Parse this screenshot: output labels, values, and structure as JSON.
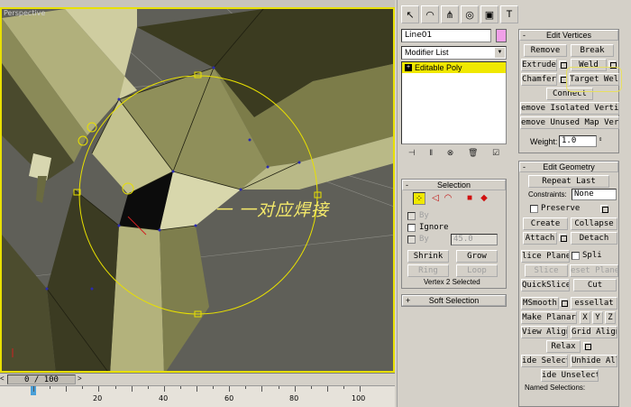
{
  "viewport": {
    "label": "Perspective",
    "annotation": "一 一对应焊接"
  },
  "time": {
    "frame_display": "0 / 100",
    "prev_arrow": "<",
    "next_arrow": ">",
    "ticks": [
      "20",
      "40",
      "60",
      "80",
      "100"
    ]
  },
  "panel": {
    "tab_icons": [
      "cursor-icon",
      "arc-icon",
      "hierarchy-icon",
      "motion-icon",
      "display-icon",
      "utilities-icon"
    ],
    "object_name": "Line01",
    "object_color": "#f0a0e8",
    "modifier_list": "Modifier List",
    "stack_item": "Editable Poly",
    "stack_item_glyph": "+",
    "stack_tool_glyphs": [
      "⊣",
      "‖",
      "⊗",
      "🗑",
      "☑"
    ]
  },
  "edit_vertices": {
    "title": "Edit Vertices",
    "collapse_glyph": "-",
    "remove": "Remove",
    "break": "Break",
    "extrude": "Extrude",
    "weld": "Weld",
    "chamfer": "Chamfer",
    "target_weld": "Target Weld",
    "connect": "Connect",
    "remove_isolated": "emove Isolated Vertice",
    "remove_unused": "emove Unused Map Vert",
    "weight_label": "Weight:",
    "weight_value": "1.0"
  },
  "selection": {
    "title": "Selection",
    "collapse_glyph": "-",
    "by_vertex": "By",
    "ignore": "Ignore",
    "by_angle": "By",
    "angle_value": "45.0",
    "shrink": "Shrink",
    "grow": "Grow",
    "ring": "Ring",
    "loop": "Loop",
    "status": "Vertex 2 Selected"
  },
  "soft_selection": {
    "title": "Soft Selection",
    "expand_glyph": "+"
  },
  "edit_geometry": {
    "title": "Edit Geometry",
    "collapse_glyph": "-",
    "repeat_last": "Repeat Last",
    "constraints_label": "Constraints:",
    "constraints_value": "None",
    "preserve": "Preserve",
    "create": "Create",
    "collapse": "Collapse",
    "attach": "Attach",
    "detach": "Detach",
    "slice_plane": "lice Plane",
    "split": "Spli",
    "slice": "Slice",
    "reset_plane": "eset Plane",
    "quickslice": "QuickSlice",
    "cut": "Cut",
    "msmooth": "MSmooth",
    "tessellate": "essellat",
    "make_planar": "Make Planar",
    "x": "X",
    "y": "Y",
    "z": "Z",
    "view_align": "View Align",
    "grid_align": "Grid Align",
    "relax": "Relax",
    "hide_selected": "ide Selecte",
    "unhide_all": "Unhide All",
    "hide_unselected": "ide Unselecte",
    "named_selections": "Named Selections:"
  }
}
